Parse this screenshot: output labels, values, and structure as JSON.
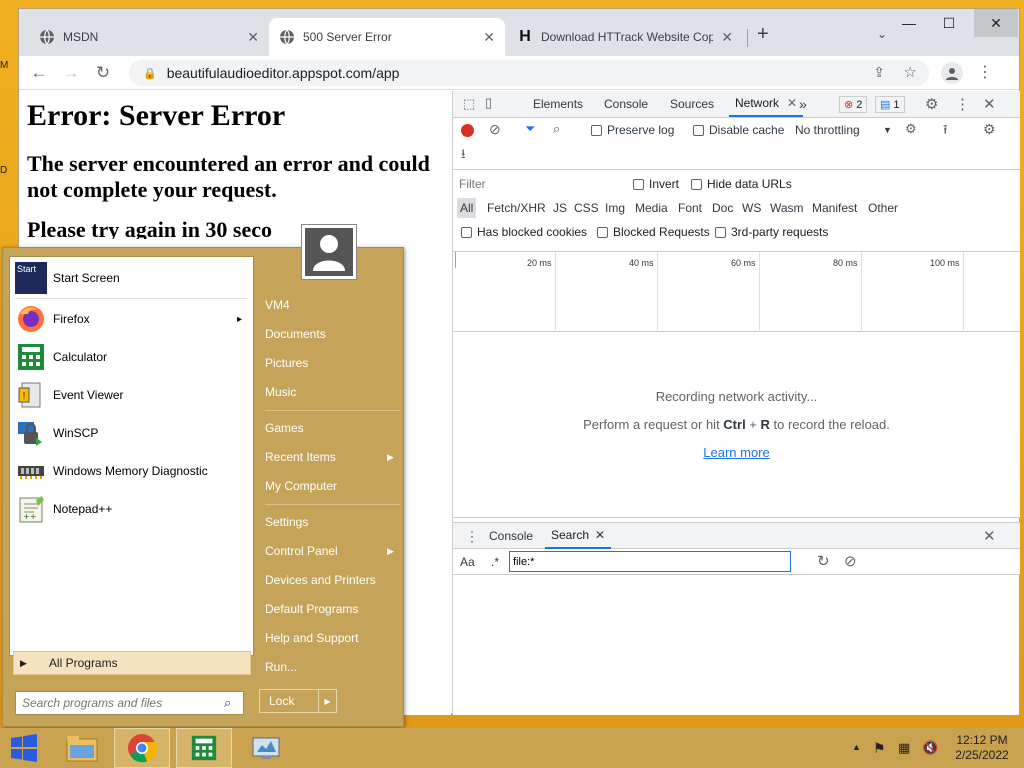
{
  "desktop": {
    "left_letters": [
      "M",
      "D"
    ]
  },
  "browser": {
    "tabs": [
      {
        "title": "MSDN",
        "icon": "globe-icon"
      },
      {
        "title": "500 Server Error",
        "icon": "globe-icon"
      },
      {
        "title": "Download HTTrack Website Copi",
        "icon": "httrack-h-icon"
      }
    ],
    "url": "beautifulaudioeditor.appspot.com/app"
  },
  "page": {
    "h1": "Error: Server Error",
    "h2": "The server encountered an error and could not complete your request.",
    "h3": "Please try again in 30 seco"
  },
  "devtools": {
    "tabs": [
      "Elements",
      "Console",
      "Sources",
      "Network"
    ],
    "more": "»",
    "errors": "2",
    "messages": "1",
    "preserve_log": "Preserve log",
    "disable_cache": "Disable cache",
    "throttling": "No throttling",
    "filter_placeholder": "Filter",
    "invert": "Invert",
    "hide_data_urls": "Hide data URLs",
    "types": [
      "All",
      "Fetch/XHR",
      "JS",
      "CSS",
      "Img",
      "Media",
      "Font",
      "Doc",
      "WS",
      "Wasm",
      "Manifest",
      "Other"
    ],
    "blocked_cookies": "Has blocked cookies",
    "blocked_requests": "Blocked Requests",
    "third_party": "3rd-party requests",
    "ticks": [
      "20 ms",
      "40 ms",
      "60 ms",
      "80 ms",
      "100 ms"
    ],
    "recording": "Recording network activity...",
    "perform_pre": "Perform a request or hit ",
    "ctrl": "Ctrl",
    "plus": " + ",
    "r": "R",
    "perform_post": " to record the reload.",
    "learn_more": "Learn more",
    "drawer_tabs": [
      "Console",
      "Search"
    ],
    "aa": "Aa",
    "regex": ".*",
    "search_value": "file:*"
  },
  "startmenu": {
    "programs": [
      {
        "label": "Start Screen",
        "icon": "start-screen-icon"
      },
      {
        "label": "Firefox",
        "icon": "firefox-icon",
        "arrow": "▸"
      },
      {
        "label": "Calculator",
        "icon": "calculator-icon"
      },
      {
        "label": "Event Viewer",
        "icon": "event-viewer-icon"
      },
      {
        "label": "WinSCP",
        "icon": "winscp-icon"
      },
      {
        "label": "Windows Memory Diagnostic",
        "icon": "memory-diagnostic-icon"
      },
      {
        "label": "Notepad++",
        "icon": "notepadpp-icon"
      }
    ],
    "all_programs": "All Programs",
    "search_placeholder": "Search programs and files",
    "right": [
      "VM4",
      "Documents",
      "Pictures",
      "Music",
      "Games",
      "Recent Items",
      "My Computer",
      "Settings",
      "Control Panel",
      "Devices and Printers",
      "Default Programs",
      "Help and Support",
      "Run..."
    ],
    "lock": "Lock",
    "start_icon_text": "Start"
  },
  "taskbar": {
    "time": "12:12 PM",
    "date": "2/25/2022"
  }
}
